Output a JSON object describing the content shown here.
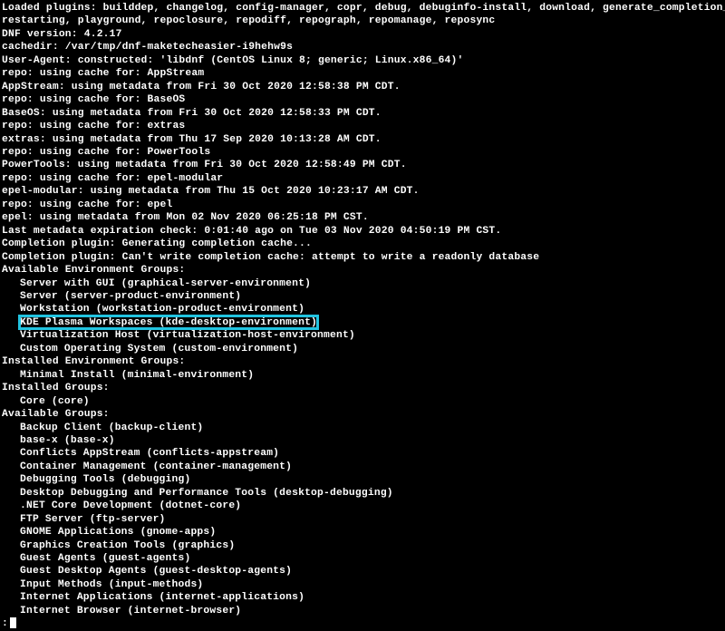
{
  "header": [
    "Loaded plugins: builddep, changelog, config-manager, copr, debug, debuginfo-install, download, generate_completion_cache, needs-",
    "restarting, playground, repoclosure, repodiff, repograph, repomanage, reposync",
    "DNF version: 4.2.17",
    "cachedir: /var/tmp/dnf-maketecheasier-i9hehw9s",
    "User-Agent: constructed: 'libdnf (CentOS Linux 8; generic; Linux.x86_64)'",
    "repo: using cache for: AppStream",
    "AppStream: using metadata from Fri 30 Oct 2020 12:58:38 PM CDT.",
    "repo: using cache for: BaseOS",
    "BaseOS: using metadata from Fri 30 Oct 2020 12:58:33 PM CDT.",
    "repo: using cache for: extras",
    "extras: using metadata from Thu 17 Sep 2020 10:13:28 AM CDT.",
    "repo: using cache for: PowerTools",
    "PowerTools: using metadata from Fri 30 Oct 2020 12:58:49 PM CDT.",
    "repo: using cache for: epel-modular",
    "epel-modular: using metadata from Thu 15 Oct 2020 10:23:17 AM CDT.",
    "repo: using cache for: epel",
    "epel: using metadata from Mon 02 Nov 2020 06:25:18 PM CST.",
    "Last metadata expiration check: 0:01:40 ago on Tue 03 Nov 2020 04:50:19 PM CST.",
    "Completion plugin: Generating completion cache...",
    "Completion plugin: Can't write completion cache: attempt to write a readonly database"
  ],
  "sections": {
    "available_env_label": "Available Environment Groups:",
    "available_env": [
      "Server with GUI (graphical-server-environment)",
      "Server (server-product-environment)",
      "Workstation (workstation-product-environment)"
    ],
    "highlighted": "KDE Plasma Workspaces (kde-desktop-environment)",
    "available_env_after": [
      "Virtualization Host (virtualization-host-environment)",
      "Custom Operating System (custom-environment)"
    ],
    "installed_env_label": "Installed Environment Groups:",
    "installed_env": [
      "Minimal Install (minimal-environment)"
    ],
    "installed_groups_label": "Installed Groups:",
    "installed_groups": [
      "Core (core)"
    ],
    "available_groups_label": "Available Groups:",
    "available_groups": [
      "Backup Client (backup-client)",
      "base-x (base-x)",
      "Conflicts AppStream (conflicts-appstream)",
      "Container Management (container-management)",
      "Debugging Tools (debugging)",
      "Desktop Debugging and Performance Tools (desktop-debugging)",
      ".NET Core Development (dotnet-core)",
      "FTP Server (ftp-server)",
      "GNOME Applications (gnome-apps)",
      "Graphics Creation Tools (graphics)",
      "Guest Agents (guest-agents)",
      "Guest Desktop Agents (guest-desktop-agents)",
      "Input Methods (input-methods)",
      "Internet Applications (internet-applications)",
      "Internet Browser (internet-browser)"
    ],
    "prompt": ":"
  }
}
